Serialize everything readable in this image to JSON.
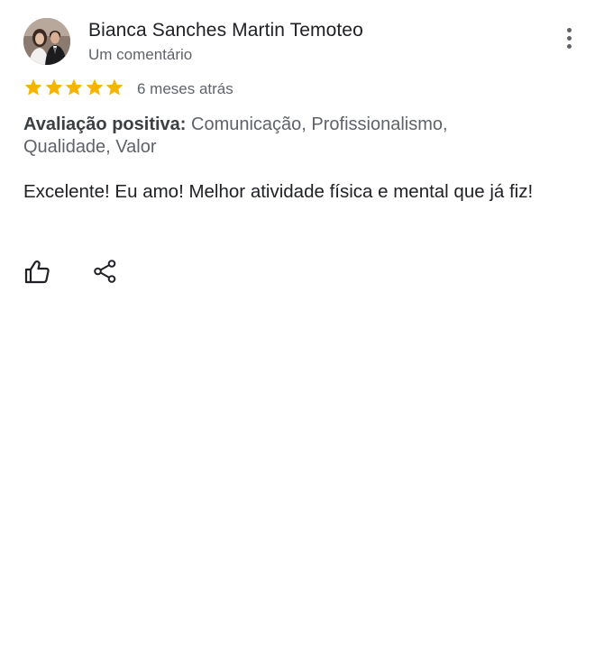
{
  "reviewer": {
    "name": "Bianca Sanches Martin Temoteo",
    "subtitle": "Um comentário",
    "avatar_icon": "profile-photo"
  },
  "rating": {
    "stars": 5,
    "max_stars": 5,
    "star_color": "#F4B400",
    "date": "6 meses atrás"
  },
  "positive": {
    "label": "Avaliação positiva:",
    "value": "Comunicação, Profissionalismo, Qualidade, Valor"
  },
  "review_text": "Excelente! Eu amo! Melhor atividade física e mental que já fiz!",
  "actions": {
    "like_icon": "thumb-up-icon",
    "share_icon": "share-icon",
    "more_icon": "more-vert-icon"
  },
  "colors": {
    "text_primary": "#202124",
    "text_secondary": "#5f6368"
  }
}
